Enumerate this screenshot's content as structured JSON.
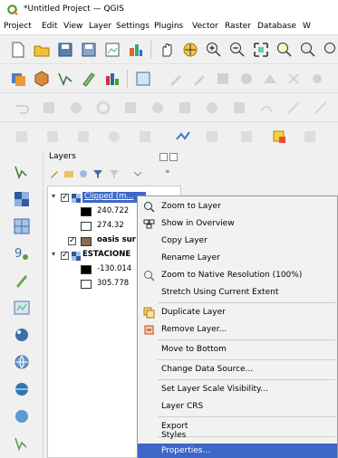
{
  "window": {
    "title": "*Untitled Project — QGIS"
  },
  "menu": [
    "Project",
    "Edit",
    "View",
    "Layer",
    "Settings",
    "Plugins",
    "Vector",
    "Raster",
    "Database",
    "W"
  ],
  "layers_panel": {
    "title": "Layers",
    "items": [
      {
        "name": "Clipped (m...",
        "type": "raster",
        "checked": true,
        "selected": true,
        "values": [
          "240.722",
          "274.32"
        ]
      },
      {
        "name": "oasis sur",
        "type": "vector",
        "checked": true,
        "color": "#8b6a4f"
      },
      {
        "name": "ESTACIONE",
        "type": "raster",
        "checked": true,
        "values": [
          "-130.014",
          "305.778"
        ]
      }
    ]
  },
  "context_menu": {
    "items": [
      {
        "label": "Zoom to Layer",
        "icon": "zoom-layer-icon"
      },
      {
        "label": "Show in Overview",
        "icon": "overview-icon"
      },
      {
        "label": "Copy Layer"
      },
      {
        "label": "Rename Layer"
      },
      {
        "label": "Zoom to Native Resolution (100%)",
        "icon": "native-resolution-icon"
      },
      {
        "label": "Stretch Using Current Extent"
      },
      {
        "label": "Duplicate Layer",
        "icon": "duplicate-icon"
      },
      {
        "label": "Remove Layer...",
        "icon": "remove-icon"
      },
      {
        "label": "Move to Bottom"
      },
      {
        "label": "Change Data Source..."
      },
      {
        "label": "Set Layer Scale Visibility..."
      },
      {
        "label": "Layer CRS"
      },
      {
        "label": "Export"
      },
      {
        "label": "Styles"
      },
      {
        "label": "Properties...",
        "selected": true
      }
    ]
  },
  "colors": {
    "selection": "#3e66c9",
    "qgis_green": "#589632"
  }
}
